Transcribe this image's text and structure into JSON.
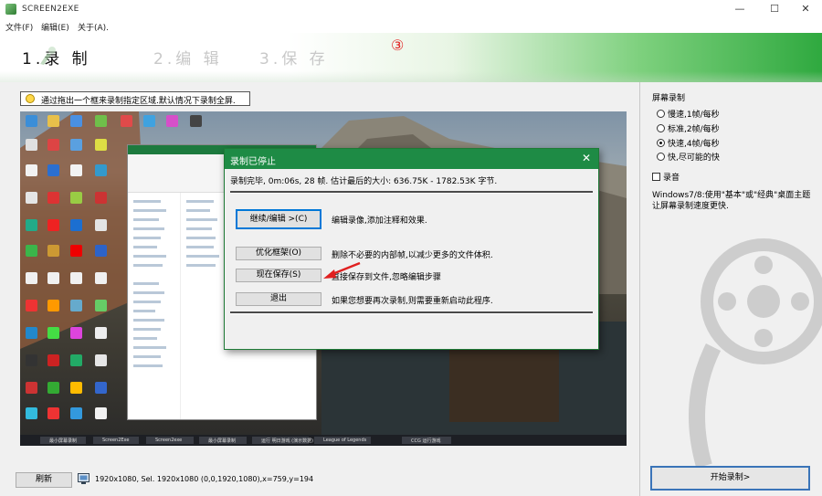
{
  "window": {
    "title": "SCREEN2EXE",
    "minimize": "—",
    "maximize": "☐",
    "close": "✕"
  },
  "menu": [
    "文件(F)",
    "编辑(E)",
    "关于(A)."
  ],
  "steps": {
    "step1": "1.录 制",
    "step2": "2.编 辑",
    "step3": "3.保 存"
  },
  "annotation": "③",
  "hint": "通过拖出一个框来录制指定区域.默认情况下录制全屏.",
  "dialog": {
    "title": "录制已停止",
    "close": "✕",
    "status": "录制完毕, 0m:06s, 28 帧. 估计最后的大小: 636.75K - 1782.53K 字节.",
    "buttons": [
      {
        "label": "继续/编辑 >(C)",
        "desc": "编辑录像,添加注释和效果."
      },
      {
        "label": "优化框架(O)",
        "desc": "删除不必要的内部帧,以减少更多的文件体积."
      },
      {
        "label": "现在保存(S)",
        "desc": "直接保存到文件,忽略编辑步骤"
      },
      {
        "label": "退出",
        "desc": "如果您想要再次录制,则需要重新启动此程序."
      }
    ]
  },
  "preview_taskbar": [
    "最小屏幕录制",
    "Screen2Exe",
    "Screen2exe",
    "最小屏幕录制",
    "运行 明日游戏 (演示数据)",
    "League of Legends",
    "CCG 运行游戏"
  ],
  "right_panel": {
    "title": "屏幕录制",
    "speed_options": [
      {
        "label": "慢速,1帧/每秒",
        "selected": false
      },
      {
        "label": "标准,2帧/每秒",
        "selected": false
      },
      {
        "label": "快速,4帧/每秒",
        "selected": true
      },
      {
        "label": "快,尽可能的快",
        "selected": false
      }
    ],
    "record_audio": {
      "label": "录音",
      "checked": false
    },
    "note": "Windows7/8:使用\"基本\"或\"经典\"桌面主题让屏幕录制速度更快.",
    "start_button": "开始录制>"
  },
  "bottom": {
    "refresh_button": "刷新",
    "info": "1920x1080, Sel. 1920x1080 (0,0,1920,1080),x=759,y=194"
  },
  "colors": {
    "accent_green": "#1e8b45",
    "annotation_red": "#e02020",
    "start_border": "#3a74b8"
  }
}
